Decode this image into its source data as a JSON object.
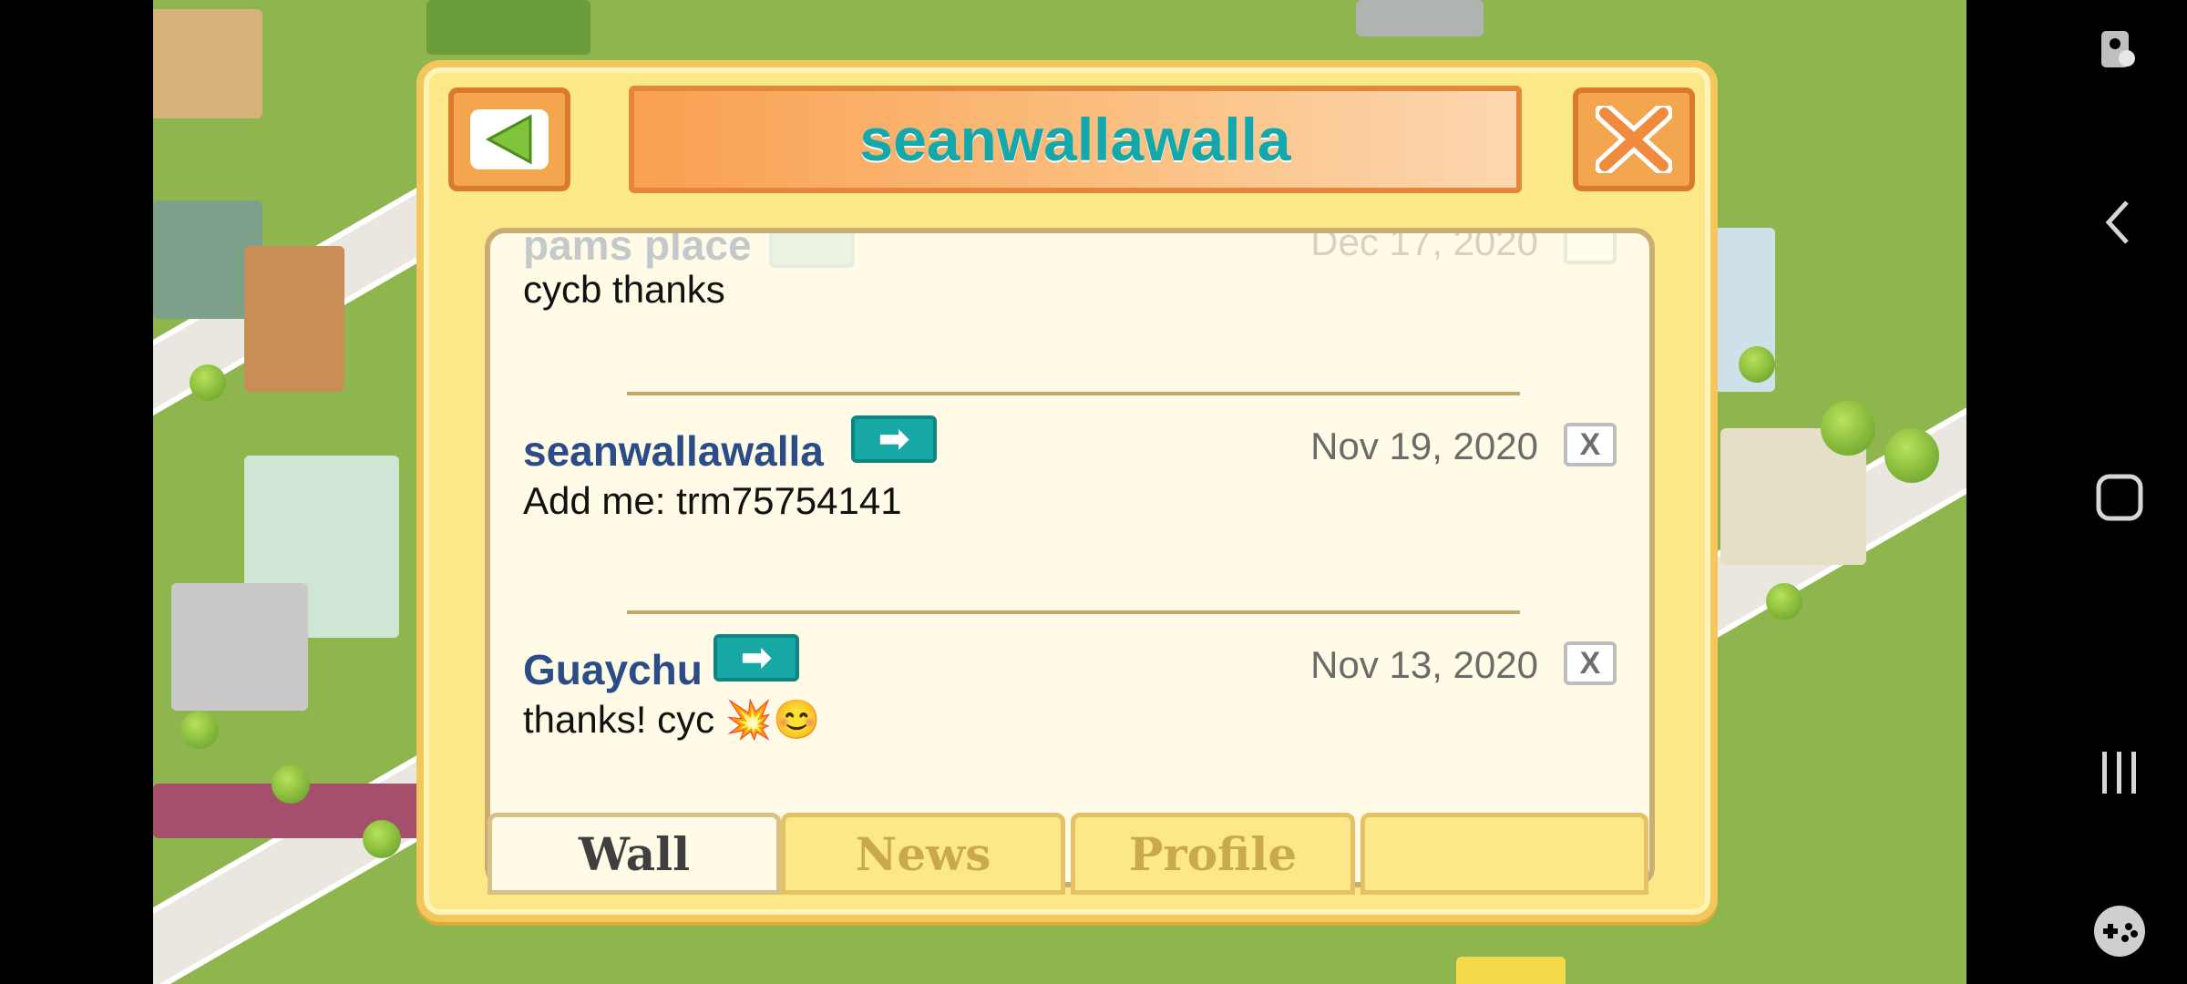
{
  "dialog": {
    "title": "seanwallawalla",
    "back_icon": "back-arrow-icon",
    "close_icon": "close-icon"
  },
  "wall": {
    "partial_post": {
      "author": "pams place",
      "date": "Dec 17, 2020",
      "message": "cycb  thanks"
    },
    "posts": [
      {
        "author": "seanwallawalla",
        "date": "Nov 19, 2020",
        "message": "Add me: trm75754141",
        "visit_symbol": "➡",
        "delete_symbol": "X"
      },
      {
        "author": "Guaychu",
        "date": "Nov 13, 2020",
        "message": "thanks! cyc 💥😊",
        "visit_symbol": "➡",
        "delete_symbol": "X"
      }
    ]
  },
  "tabs": [
    {
      "label": "Wall",
      "active": true
    },
    {
      "label": "News",
      "active": false
    },
    {
      "label": "Profile",
      "active": false
    },
    {
      "label": "",
      "active": false
    }
  ],
  "colors": {
    "title": "#13a8ac",
    "author": "#2b4c86",
    "dialog_bg": "#fde889",
    "panel_bg": "#fffbe7"
  }
}
